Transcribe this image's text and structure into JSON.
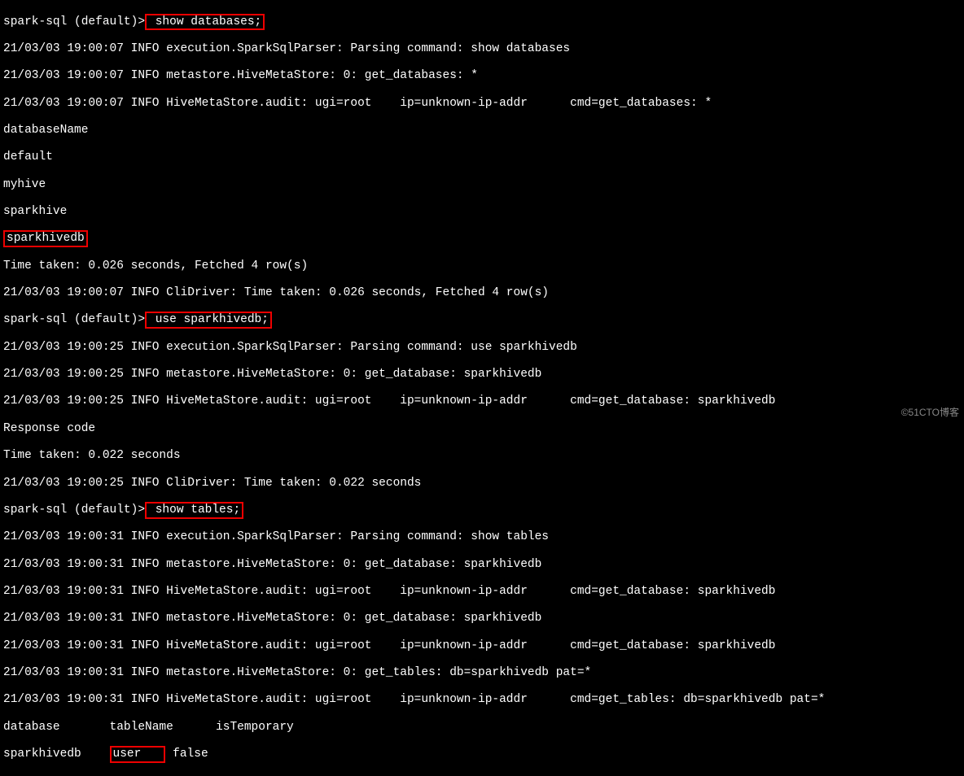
{
  "prompt": "spark-sql (default)>",
  "cmd1": " show databases;",
  "log1": "21/03/03 19:00:07 INFO execution.SparkSqlParser: Parsing command: show databases",
  "log2": "21/03/03 19:00:07 INFO metastore.HiveMetaStore: 0: get_databases: *",
  "log3": "21/03/03 19:00:07 INFO HiveMetaStore.audit: ugi=root    ip=unknown-ip-addr      cmd=get_databases: *",
  "hdr_db": "databaseName",
  "db1": "default",
  "db2": "myhive",
  "db3": "sparkhive",
  "db4": "sparkhivedb",
  "time1": "Time taken: 0.026 seconds, Fetched 4 row(s)",
  "log4": "21/03/03 19:00:07 INFO CliDriver: Time taken: 0.026 seconds, Fetched 4 row(s)",
  "cmd2": " use sparkhivedb;",
  "log5": "21/03/03 19:00:25 INFO execution.SparkSqlParser: Parsing command: use sparkhivedb",
  "log6": "21/03/03 19:00:25 INFO metastore.HiveMetaStore: 0: get_database: sparkhivedb",
  "log7": "21/03/03 19:00:25 INFO HiveMetaStore.audit: ugi=root    ip=unknown-ip-addr      cmd=get_database: sparkhivedb",
  "resp": "Response code",
  "time2": "Time taken: 0.022 seconds",
  "log8": "21/03/03 19:00:25 INFO CliDriver: Time taken: 0.022 seconds",
  "cmd3": " show tables;",
  "log9": "21/03/03 19:00:31 INFO execution.SparkSqlParser: Parsing command: show tables",
  "log10": "21/03/03 19:00:31 INFO metastore.HiveMetaStore: 0: get_database: sparkhivedb",
  "log11": "21/03/03 19:00:31 INFO HiveMetaStore.audit: ugi=root    ip=unknown-ip-addr      cmd=get_database: sparkhivedb",
  "log12": "21/03/03 19:00:31 INFO metastore.HiveMetaStore: 0: get_database: sparkhivedb",
  "log13": "21/03/03 19:00:31 INFO HiveMetaStore.audit: ugi=root    ip=unknown-ip-addr      cmd=get_database: sparkhivedb",
  "log14": "21/03/03 19:00:31 INFO metastore.HiveMetaStore: 0: get_tables: db=sparkhivedb pat=*",
  "log15": "21/03/03 19:00:31 INFO HiveMetaStore.audit: ugi=root    ip=unknown-ip-addr      cmd=get_tables: db=sparkhivedb pat=*",
  "hdr_tbl": "database       tableName      isTemporary",
  "row_db": "sparkhivedb    ",
  "row_tbl": "user   ",
  "row_tmp": " false",
  "watermark": "©51CTO博客"
}
